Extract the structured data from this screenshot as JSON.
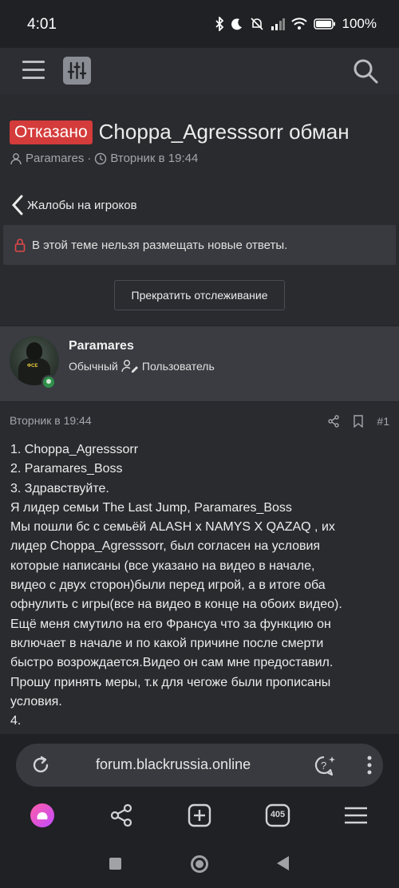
{
  "status_bar": {
    "time": "4:01",
    "battery": "100%"
  },
  "thread": {
    "status_badge": "Отказано",
    "title": "Choppa_Agresssorr обман",
    "author": "Paramares",
    "separator": "·",
    "date": "Вторник в 19:44"
  },
  "breadcrumb": {
    "label": "Жалобы на игроков"
  },
  "notice": {
    "text": "В этой теме нельзя размещать новые ответы."
  },
  "watch_button": {
    "label": "Прекратить отслеживание"
  },
  "user": {
    "name": "Paramares",
    "rank": "Обычный",
    "role": "Пользователь",
    "avatar_text": "ФСЕ"
  },
  "post": {
    "date": "Вторник в 19:44",
    "number": "#1",
    "lines": [
      "1. Choppa_Agresssorr",
      "2. Paramares_Boss",
      "3. Здравствуйте.",
      "Я лидер семьи The Last Jump, Paramares_Boss",
      "Мы пошли бс с семьёй ALASH x NAMYS X QAZAQ , их",
      "лидер Choppa_Agresssorr, был согласен на условия",
      "которые написаны (все указано на видео в начале,",
      "видео с двух сторон)были перед игрой, а в итоге оба",
      "офнулить с игры(все на видео в конце на обоих видео).",
      "Ещё меня смутило на его Франсуа что за функцию он",
      "включает в начале и по какой причине после смерти",
      "быстро возрождается.Видео он сам мне предоставил.",
      "Прошу принять меры, т.к для чегоже были прописаны",
      "условия.",
      "4."
    ]
  },
  "browser": {
    "url": "forum.blackrussia.online",
    "tab_count": "405"
  },
  "colors": {
    "badge_red": "#d43b3b",
    "page_bg": "#2a2b2f",
    "user_block_bg": "#3a3c42"
  }
}
